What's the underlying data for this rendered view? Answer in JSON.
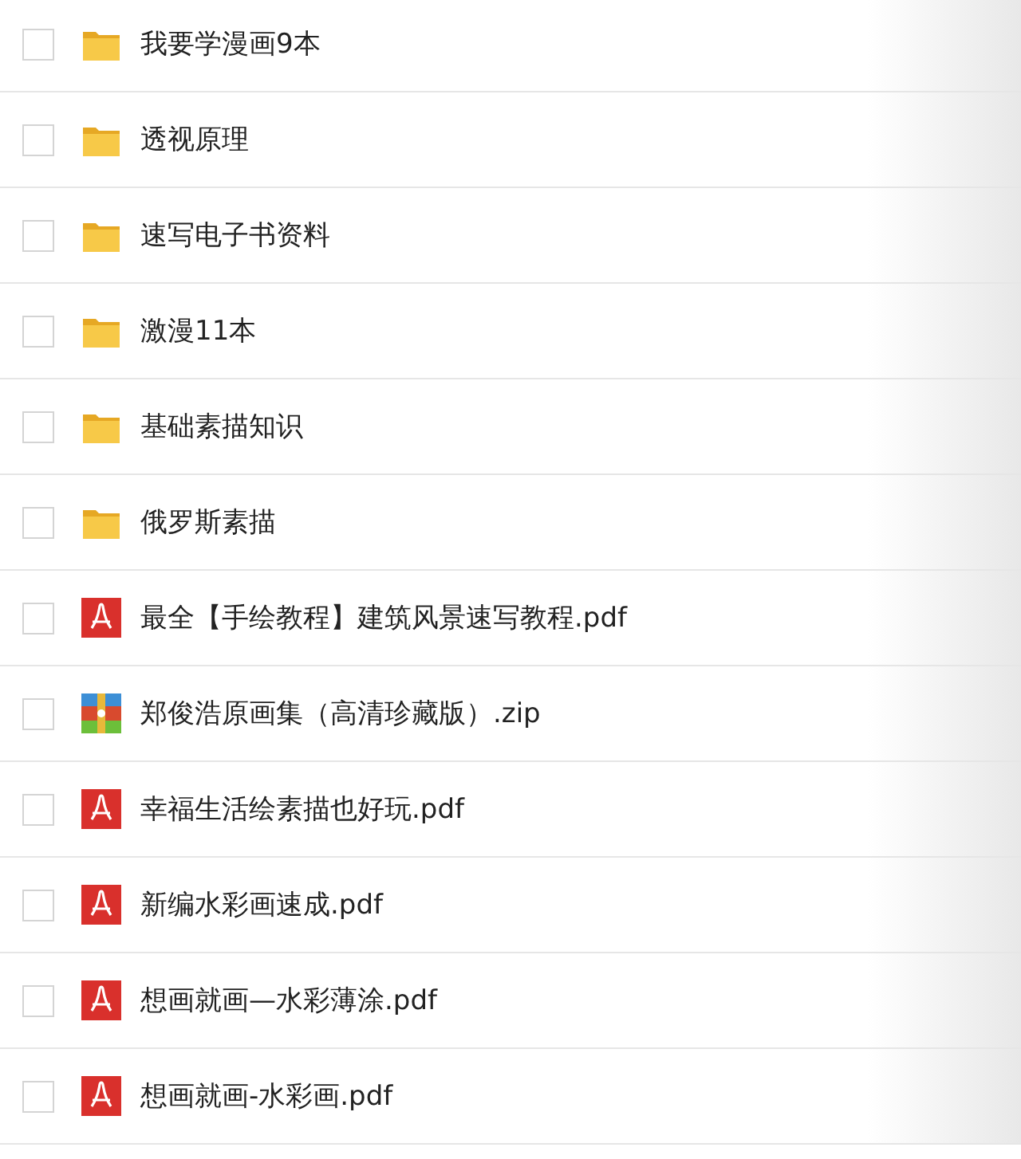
{
  "files": [
    {
      "kind": "folder",
      "name": "我要学漫画9本",
      "checked": false
    },
    {
      "kind": "folder",
      "name": "透视原理",
      "checked": false
    },
    {
      "kind": "folder",
      "name": "速写电子书资料",
      "checked": false
    },
    {
      "kind": "folder",
      "name": "激漫11本",
      "checked": false
    },
    {
      "kind": "folder",
      "name": "基础素描知识",
      "checked": false
    },
    {
      "kind": "folder",
      "name": "俄罗斯素描",
      "checked": false
    },
    {
      "kind": "pdf",
      "name": "最全【手绘教程】建筑风景速写教程.pdf",
      "checked": false
    },
    {
      "kind": "zip",
      "name": "郑俊浩原画集（高清珍藏版）.zip",
      "checked": false
    },
    {
      "kind": "pdf",
      "name": "幸福生活绘素描也好玩.pdf",
      "checked": false
    },
    {
      "kind": "pdf",
      "name": "新编水彩画速成.pdf",
      "checked": false
    },
    {
      "kind": "pdf",
      "name": "想画就画—水彩薄涂.pdf",
      "checked": false
    },
    {
      "kind": "pdf",
      "name": "想画就画-水彩画.pdf",
      "checked": false
    }
  ]
}
